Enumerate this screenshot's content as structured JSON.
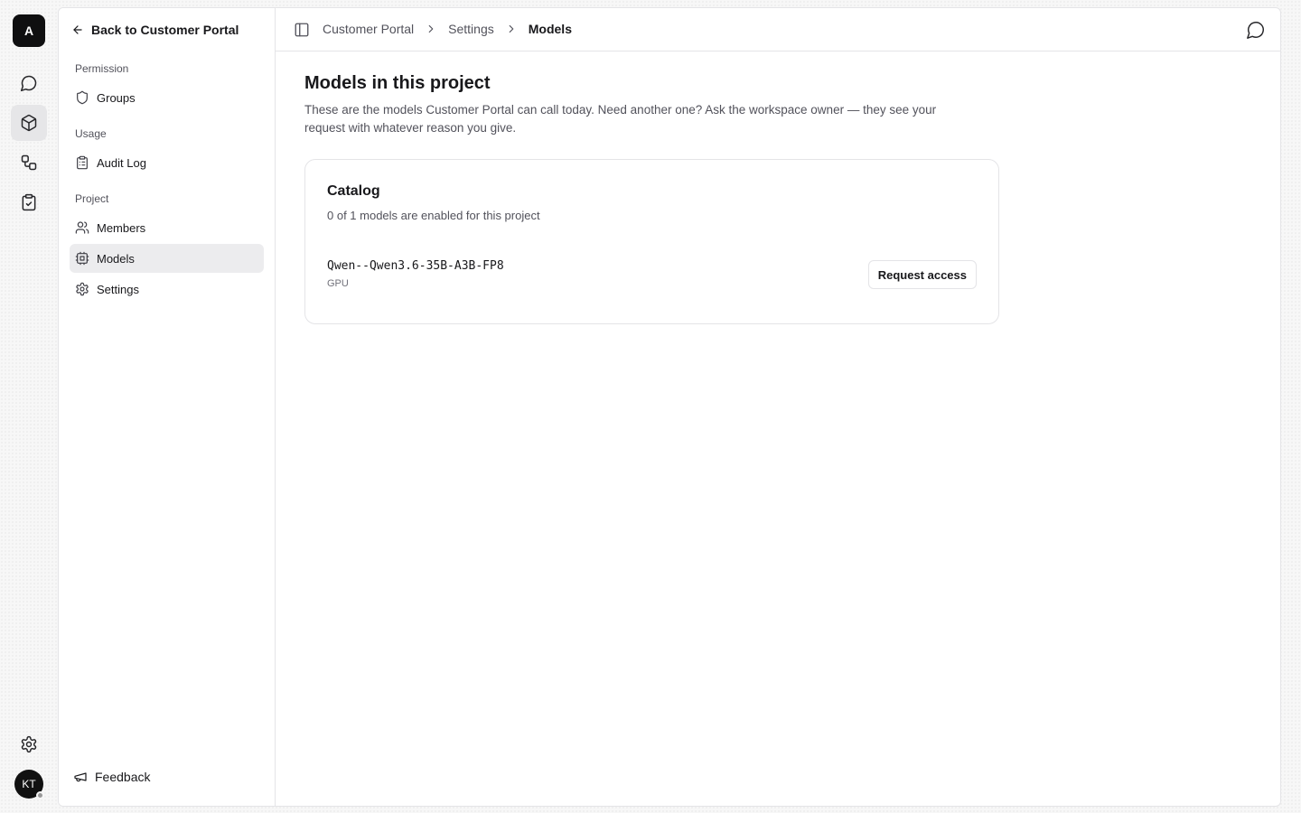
{
  "rail": {
    "logo": "A",
    "avatar": "KT",
    "items": [
      {
        "icon": "chat-icon"
      },
      {
        "icon": "cube-icon",
        "active": true
      },
      {
        "icon": "workflow-icon"
      },
      {
        "icon": "clipboard-check-icon"
      }
    ],
    "settings_icon": "gear-icon"
  },
  "sidebar": {
    "back_label": "Back to Customer Portal",
    "sections": {
      "permission": "Permission",
      "usage": "Usage",
      "project": "Project"
    },
    "items": {
      "groups": "Groups",
      "audit_log": "Audit Log",
      "members": "Members",
      "models": "Models",
      "settings": "Settings"
    },
    "active_item": "Models",
    "feedback": "Feedback"
  },
  "header": {
    "breadcrumb": [
      "Customer Portal",
      "Settings",
      "Models"
    ]
  },
  "main": {
    "title": "Models in this project",
    "description": "These are the models Customer Portal can call today. Need another one? Ask the workspace owner — they see your request with whatever reason you give.",
    "catalog": {
      "title": "Catalog",
      "summary": "0 of 1 models are enabled for this project",
      "models": [
        {
          "name": "Qwen--Qwen3.6-35B-A3B-FP8",
          "tag": "GPU",
          "action": "Request access"
        }
      ]
    }
  },
  "colors": {
    "accent": "#0f0f10",
    "active_bg": "#ececee",
    "border": "#e4e4e7",
    "muted_text": "#52525b"
  }
}
